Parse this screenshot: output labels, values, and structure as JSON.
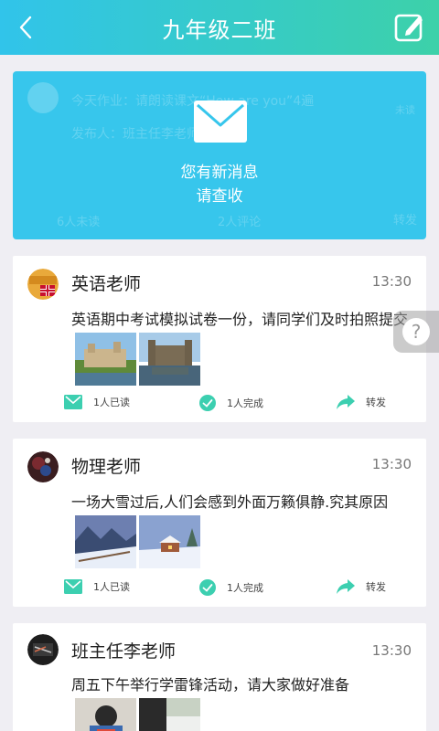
{
  "header": {
    "title": "九年级二班"
  },
  "notice": {
    "ghost_text": "今天作业：请朗读课文“How are you”4遍",
    "ghost_publisher": "发布人：班主任李老师",
    "ghost_side": "未读",
    "ghost_unread": "6人未读",
    "ghost_comments": "2人评论",
    "ghost_forward": "转发",
    "line1": "您有新消息",
    "line2": "请查收"
  },
  "posts": [
    {
      "teacher": "英语老师",
      "time": "13:30",
      "content": "英语期中考试模拟试卷一份，请同学们及时拍照提交",
      "read": "1人已读",
      "done": "1人完成",
      "forward": "转发"
    },
    {
      "teacher": "物理老师",
      "time": "13:30",
      "content": "一场大雪过后,人们会感到外面万籁俱静.究其原因",
      "read": "1人已读",
      "done": "1人完成",
      "forward": "转发"
    },
    {
      "teacher": "班主任李老师",
      "time": "13:30",
      "content": "周五下午举行学雷锋活动，请大家做好准备"
    }
  ],
  "help": {
    "symbol": "?"
  },
  "colors": {
    "header_start": "#31c4ea",
    "header_end": "#3dd1a9",
    "notice_bg": "#37c6ec",
    "accent_green": "#3ccfb0",
    "page_bg": "#efeef3"
  },
  "icons": [
    "back-arrow-icon",
    "edit-icon",
    "envelope-icon",
    "mail-icon",
    "check-circle-icon",
    "forward-arrow-icon",
    "help-icon"
  ]
}
